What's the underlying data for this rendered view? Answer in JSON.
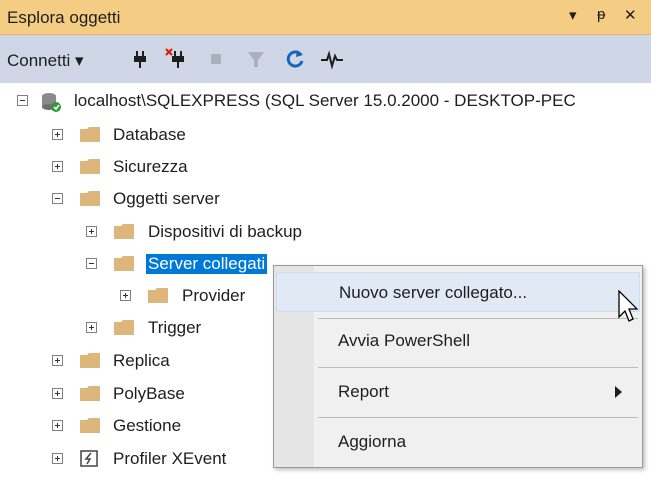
{
  "window": {
    "title": "Esplora oggetti",
    "controls": {
      "dropdown": "▾",
      "pin": "ᵽ",
      "close": "✕"
    }
  },
  "toolbar": {
    "connect_label": "Connetti ▾"
  },
  "tree": {
    "root": "localhost\\SQLEXPRESS (SQL Server 15.0.2000 - DESKTOP-PEC",
    "items": {
      "database": "Database",
      "sicurezza": "Sicurezza",
      "oggetti_server": "Oggetti server",
      "dispositivi_backup": "Dispositivi di backup",
      "server_collegati": "Server collegati",
      "provider": "Provider",
      "trigger": "Trigger",
      "replica": "Replica",
      "polybase": "PolyBase",
      "gestione": "Gestione",
      "profiler": "Profiler XEvent"
    }
  },
  "context_menu": {
    "items": [
      "Nuovo server collegato...",
      "Avvia PowerShell",
      "Report",
      "Aggiorna"
    ]
  },
  "colors": {
    "title_bar": "#f5cc84",
    "toolbar": "#cfd6e5",
    "selection": "#0078d7",
    "folder": "#dcb67a"
  }
}
